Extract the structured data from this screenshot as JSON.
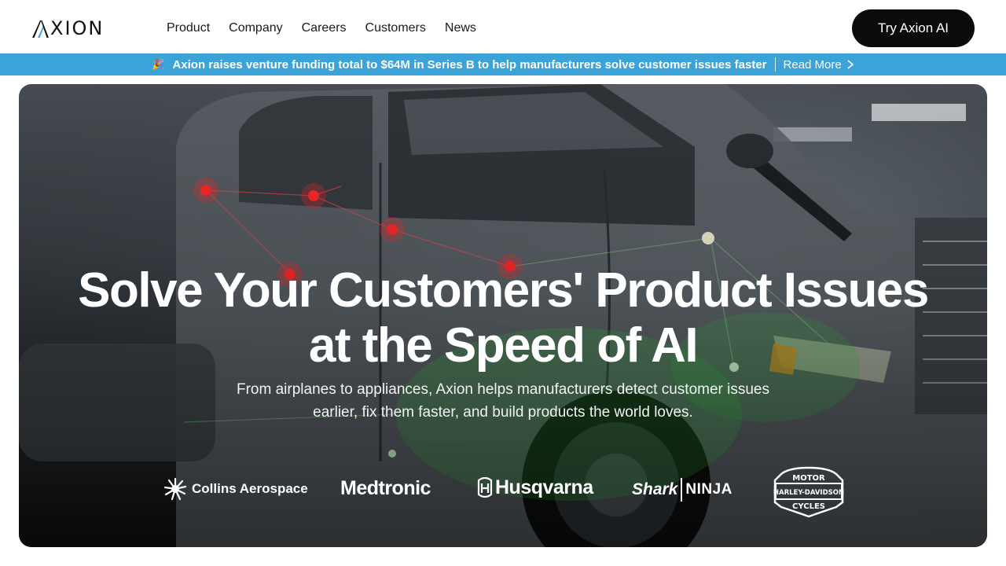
{
  "header": {
    "logo_text": "XION",
    "nav": [
      "Product",
      "Company",
      "Careers",
      "Customers",
      "News"
    ],
    "cta_label": "Try Axion AI"
  },
  "banner": {
    "emoji": "🎉",
    "message": "Axion raises venture funding total to $64M in Series B to help manufacturers solve customer issues faster",
    "link_label": "Read More",
    "color": "#3ba3d8"
  },
  "hero": {
    "title_line1": "Solve Your Customers' Product Issues",
    "title_line2": "at the Speed of AI",
    "subtitle_line1": "From airplanes to appliances, Axion helps manufacturers detect customer issues",
    "subtitle_line2": "earlier, fix them faster, and build products the world loves.",
    "logos": {
      "collins": "Collins Aerospace",
      "medtronic": "Medtronic",
      "husqvarna": "Husqvarna",
      "shark": "Shark",
      "ninja": "NINJA",
      "hd_top": "MOTOR",
      "hd_mid": "HARLEY-DAVIDSON",
      "hd_bottom": "CYCLES"
    }
  }
}
